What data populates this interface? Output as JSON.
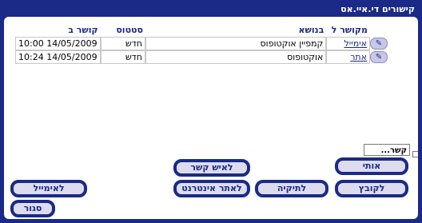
{
  "window": {
    "title": "קישורים די.איי.אס"
  },
  "table": {
    "headers": {
      "linked_to": "מקושר ל",
      "subject": "בנושא",
      "status": "סטטוס",
      "linked_at": "קושר ב"
    },
    "rows": [
      {
        "icon": "edit-pen-icon",
        "linked_to": "אימייל",
        "subject": "קמפיין אוקטופוס",
        "status": "חדש",
        "linked_at": "10:00 14/05/2009"
      },
      {
        "icon": "edit-pen-icon",
        "linked_to": "אתר",
        "subject": "אוקטופוס",
        "status": "חדש",
        "linked_at": "10:24 14/05/2009"
      }
    ]
  },
  "contact_field": {
    "value": "קשר..."
  },
  "buttons": {
    "me": "אותי",
    "to_contact": "לאיש קשר",
    "to_file": "לקובץ",
    "to_folder": "לתיקיה",
    "to_website": "לאתר אינטרנט",
    "to_email": "לאימייל",
    "close": "סגור"
  },
  "colors": {
    "frame": "#1a2a86",
    "button_fill": "#dcdcee",
    "grid_border": "#c8c8c8"
  }
}
